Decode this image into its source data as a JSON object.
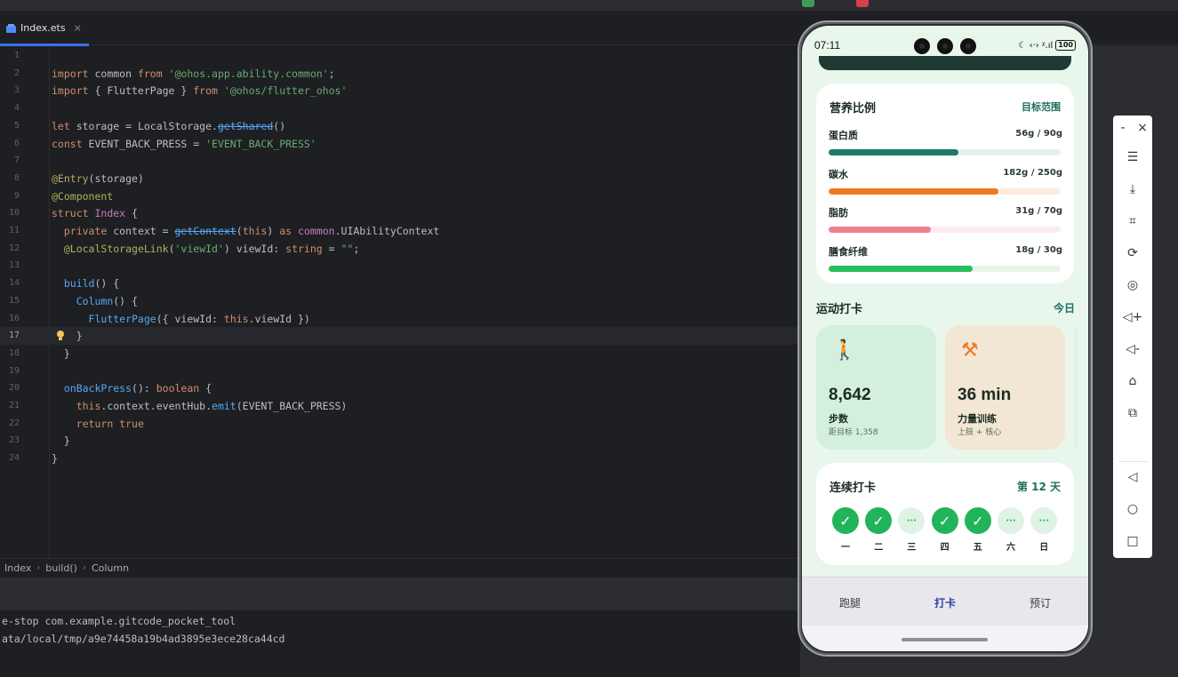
{
  "tab": {
    "file_name": "Index.ets",
    "close": "×"
  },
  "code_lines": [
    {
      "n": "1",
      "html": ""
    },
    {
      "n": "2",
      "html": "<span class=\"k\">import</span> common <span class=\"k\">from</span> <span class=\"s\">'@ohos.app.ability.common'</span>;"
    },
    {
      "n": "3",
      "html": "<span class=\"k\">import</span> { FlutterPage } <span class=\"k\">from</span> <span class=\"s\">'@ohos/flutter_ohos'</span>"
    },
    {
      "n": "4",
      "html": ""
    },
    {
      "n": "5",
      "html": "<span class=\"k\">let</span> storage = LocalStorage.<span class=\"f x\">getShared</span>()"
    },
    {
      "n": "6",
      "html": "<span class=\"k\">const</span> EVENT_BACK_PRESS = <span class=\"s\">'EVENT_BACK_PRESS'</span>"
    },
    {
      "n": "7",
      "html": ""
    },
    {
      "n": "8",
      "html": "<span class=\"d\">@Entry</span>(storage)"
    },
    {
      "n": "9",
      "html": "<span class=\"d\">@Component</span>"
    },
    {
      "n": "10",
      "html": "<span class=\"k\">struct</span> <span class=\"t\">Index</span> {"
    },
    {
      "n": "11",
      "html": "  <span class=\"k\">private</span> context = <span class=\"f x\">getContext</span>(<span class=\"k\">this</span>) <span class=\"k\">as</span> <span class=\"t\">common</span>.UIAbilityContext"
    },
    {
      "n": "12",
      "html": "  <span class=\"d\">@LocalStorageLink</span>(<span class=\"s\">'viewId'</span>) viewId: <span class=\"k\">string</span> = <span class=\"s\">\"\"</span>;"
    },
    {
      "n": "13",
      "html": ""
    },
    {
      "n": "14",
      "html": "  <span class=\"f\">build</span>() {"
    },
    {
      "n": "15",
      "html": "    <span class=\"f\">Column</span>() {"
    },
    {
      "n": "16",
      "html": "      <span class=\"f\">FlutterPage</span>({ viewId: <span class=\"k\">this</span>.viewId })"
    },
    {
      "n": "17",
      "html": "    }"
    },
    {
      "n": "18",
      "html": "  }"
    },
    {
      "n": "19",
      "html": ""
    },
    {
      "n": "20",
      "html": "  <span class=\"f\">onBackPress</span>(): <span class=\"k\">boolean</span> {"
    },
    {
      "n": "21",
      "html": "    <span class=\"k\">this</span>.context.eventHub.<span class=\"f\">emit</span>(EVENT_BACK_PRESS)"
    },
    {
      "n": "22",
      "html": "    <span class=\"k\">return</span> <span class=\"k\">true</span>"
    },
    {
      "n": "23",
      "html": "  }"
    },
    {
      "n": "24",
      "html": "}"
    }
  ],
  "current_line": "17",
  "breadcrumb": [
    "Index",
    "build()",
    "Column"
  ],
  "console_lines": [
    "e-stop com.example.gitcode_pocket_tool",
    "ata/local/tmp/a9e74458a19b4ad3895e3ece28ca44cd"
  ],
  "phone": {
    "time": "07:11",
    "status_icons": "☾ ‹·› ᵡ.ıl",
    "battery": "100",
    "nutrition": {
      "title": "营养比例",
      "link": "目标范围",
      "items": [
        {
          "label": "蛋白质",
          "value": "56g / 90g",
          "fraction": 0.56,
          "color": "#1e7a6a",
          "track": "#e3f1ee"
        },
        {
          "label": "碳水",
          "value": "182g / 250g",
          "fraction": 0.73,
          "color": "#f07a23",
          "track": "#fdece3"
        },
        {
          "label": "脂肪",
          "value": "31g / 70g",
          "fraction": 0.44,
          "color": "#f07f8c",
          "track": "#fdecef"
        },
        {
          "label": "膳食纤维",
          "value": "18g / 30g",
          "fraction": 0.62,
          "color": "#27bf5b",
          "track": "#e3f6e8"
        }
      ]
    },
    "exercise": {
      "title": "运动打卡",
      "link": "今日",
      "cards": [
        {
          "icon": "walking-icon",
          "glyph": "🚶",
          "value": "8,642",
          "label": "步数",
          "sub": "距目标 1,358",
          "bg": "#d3f0dd",
          "icon_color": "#1f9a4c"
        },
        {
          "icon": "dumbbell-icon",
          "glyph": "⚒",
          "value": "36 min",
          "label": "力量训练",
          "sub": "上肢 + 核心",
          "bg": "#f2e6d4",
          "icon_color": "#f07a23"
        }
      ]
    },
    "streak": {
      "title": "连续打卡",
      "count": "第 12 天",
      "days": [
        {
          "label": "一",
          "done": true,
          "mark": "✓"
        },
        {
          "label": "二",
          "done": true,
          "mark": "✓"
        },
        {
          "label": "三",
          "done": false,
          "mark": "···"
        },
        {
          "label": "四",
          "done": true,
          "mark": "✓"
        },
        {
          "label": "五",
          "done": true,
          "mark": "✓"
        },
        {
          "label": "六",
          "done": false,
          "mark": "···"
        },
        {
          "label": "日",
          "done": false,
          "mark": "···"
        }
      ]
    },
    "nav": [
      {
        "label": "跑腿",
        "active": false
      },
      {
        "label": "打卡",
        "active": true
      },
      {
        "label": "预订",
        "active": false
      }
    ]
  },
  "emulator_tools": [
    {
      "name": "minimize-button",
      "glyph": "-"
    },
    {
      "name": "close-icon",
      "glyph": "×"
    },
    {
      "name": "menu-icon",
      "glyph": "☰"
    },
    {
      "name": "screenshot-off-icon",
      "glyph": "⤓"
    },
    {
      "name": "crop-icon",
      "glyph": "⌗"
    },
    {
      "name": "rotate-icon",
      "glyph": "⟳"
    },
    {
      "name": "record-icon",
      "glyph": "◎"
    },
    {
      "name": "volume-up-icon",
      "glyph": "◁+"
    },
    {
      "name": "volume-down-icon",
      "glyph": "◁-"
    },
    {
      "name": "shake-icon",
      "glyph": "⌂"
    },
    {
      "name": "multi-device-icon",
      "glyph": "⧉"
    },
    {
      "name": "back-icon",
      "glyph": "◁"
    },
    {
      "name": "home-icon",
      "glyph": "○"
    },
    {
      "name": "recents-icon",
      "glyph": "□"
    }
  ]
}
